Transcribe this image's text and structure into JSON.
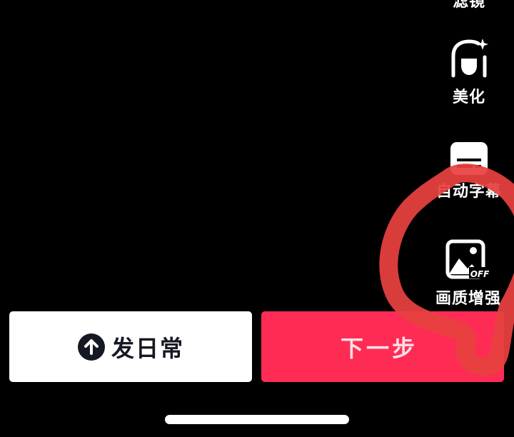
{
  "side_toolbar": {
    "filter_label": "滤镜",
    "beauty_label": "美化",
    "caption_label": "自动字幕",
    "enhance_label": "画质增强",
    "enhance_badge": "OFF"
  },
  "bottom_actions": {
    "publish_daily_label": "发日常",
    "next_step_label": "下一步"
  },
  "colors": {
    "background": "#000000",
    "next_button": "#fe2c55",
    "publish_button": "#ffffff",
    "annotation": "#e8413f"
  },
  "icons": {
    "beauty": "beauty-face-icon",
    "caption": "caption-icon",
    "enhance": "image-enhance-icon",
    "publish": "arrow-up-circle-icon"
  }
}
